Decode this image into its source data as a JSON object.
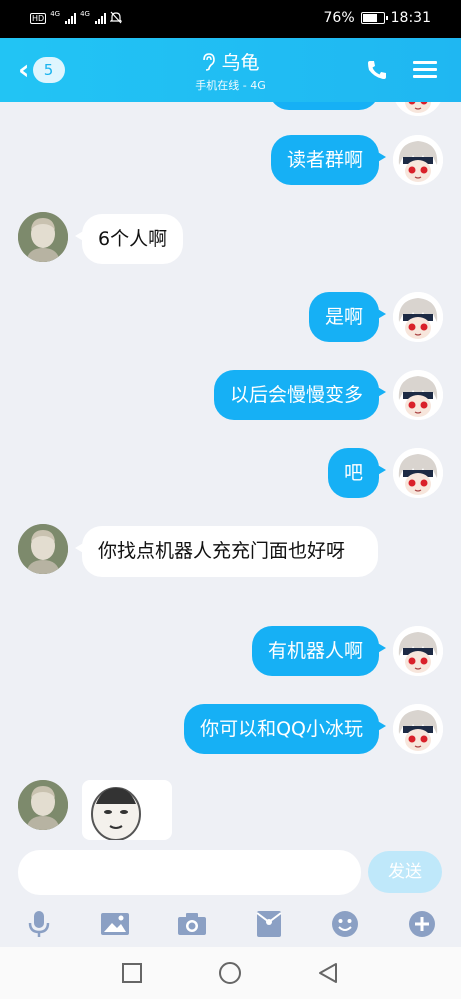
{
  "status_bar": {
    "battery_percent": "76%",
    "time": "18:31",
    "battery_level": 0.76,
    "network_left": "4G",
    "network_right": "4G",
    "hd_label": "HD"
  },
  "header": {
    "unread_count": "5",
    "contact_name": "乌龟",
    "status_text": "手机在线 - 4G",
    "icons": [
      "chevron-left-icon",
      "ear-icon",
      "phone-icon",
      "menu-icon"
    ]
  },
  "messages": [
    {
      "side": "out",
      "text": "读者群啊"
    },
    {
      "side": "in",
      "text": "6个人啊"
    },
    {
      "side": "out",
      "text": "是啊"
    },
    {
      "side": "out",
      "text": "以后会慢慢变多"
    },
    {
      "side": "out",
      "text": "吧"
    },
    {
      "side": "in",
      "text": "你找点机器人充充门面也好呀"
    },
    {
      "side": "out",
      "text": "有机器人啊"
    },
    {
      "side": "out",
      "text": "你可以和QQ小冰玩"
    },
    {
      "side": "in",
      "type": "sticker"
    }
  ],
  "input": {
    "value": "",
    "placeholder": "",
    "send_label": "发送"
  },
  "toolbar": {
    "icons": [
      "microphone-icon",
      "image-icon",
      "camera-icon",
      "red-packet-icon",
      "emoji-icon",
      "plus-icon"
    ]
  },
  "nav": {
    "icons": [
      "recent-apps-icon",
      "home-icon",
      "back-icon"
    ]
  },
  "colors": {
    "accent": "#16b0f5",
    "header": "#22c4f4",
    "background": "#eef0f5"
  }
}
